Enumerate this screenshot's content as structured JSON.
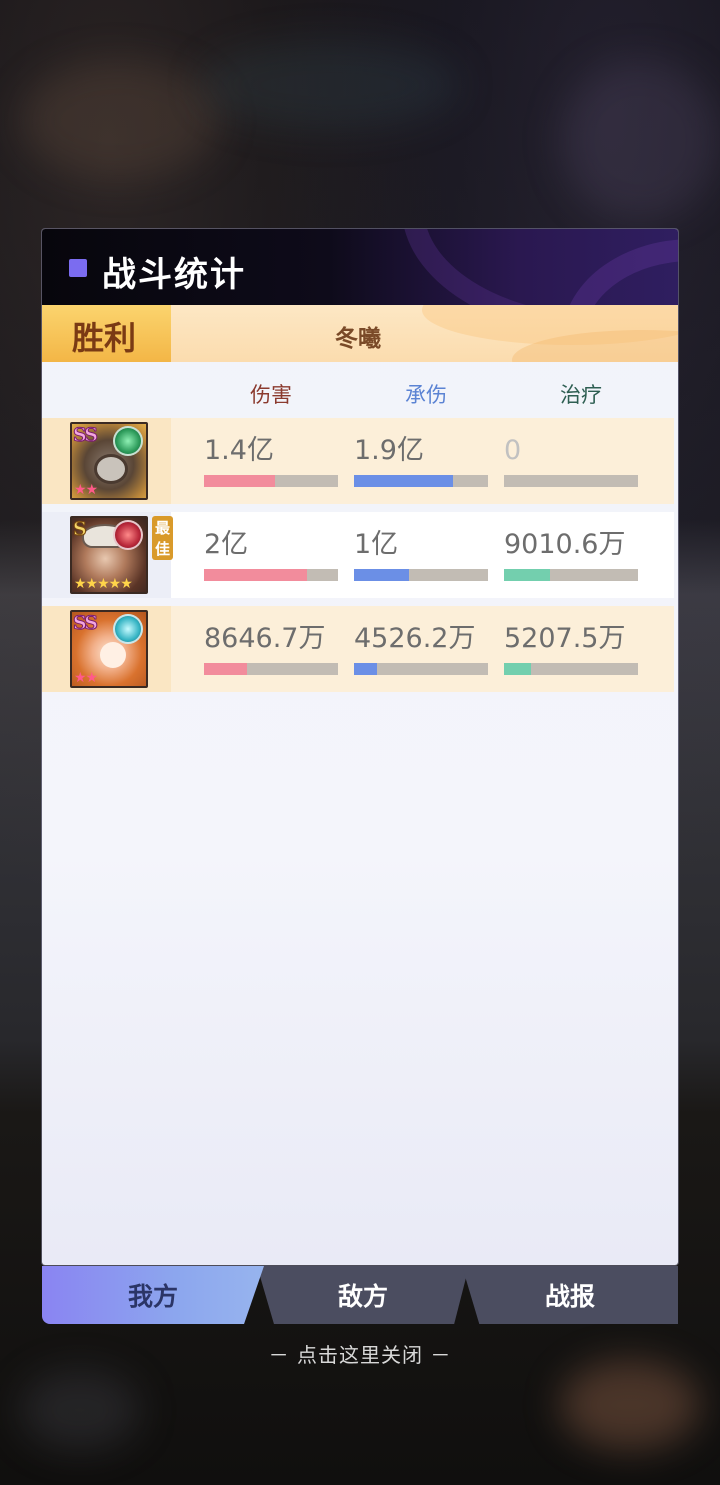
{
  "panel": {
    "title": "战斗统计",
    "result": "胜利",
    "player_name": "冬曦"
  },
  "columns": {
    "damage": "伤害",
    "taken": "承伤",
    "heal": "治疗"
  },
  "accent_colors": {
    "damage": "#f28c9c",
    "taken": "#6b8fe6",
    "heal": "#73cfae"
  },
  "rows": [
    {
      "grade": "SS",
      "element": "green-leaf-icon",
      "stars": "★★",
      "best": "",
      "damage": "1.4亿",
      "damage_frac": 0.53,
      "taken": "1.9亿",
      "taken_frac": 0.74,
      "heal": "0",
      "heal_frac": 0
    },
    {
      "grade": "S",
      "element": "red-flame-icon",
      "stars": "★★★★★",
      "best": "最佳",
      "damage": "2亿",
      "damage_frac": 0.77,
      "taken": "1亿",
      "taken_frac": 0.41,
      "heal": "9010.6万",
      "heal_frac": 0.34
    },
    {
      "grade": "SS",
      "element": "cyan-swirl-icon",
      "stars": "★★",
      "best": "",
      "damage": "8646.7万",
      "damage_frac": 0.32,
      "taken": "4526.2万",
      "taken_frac": 0.17,
      "heal": "5207.5万",
      "heal_frac": 0.2
    }
  ],
  "tabs": {
    "mine": "我方",
    "enemy": "敌方",
    "report": "战报"
  },
  "close_hint": "－ 点击这里关闭 －"
}
